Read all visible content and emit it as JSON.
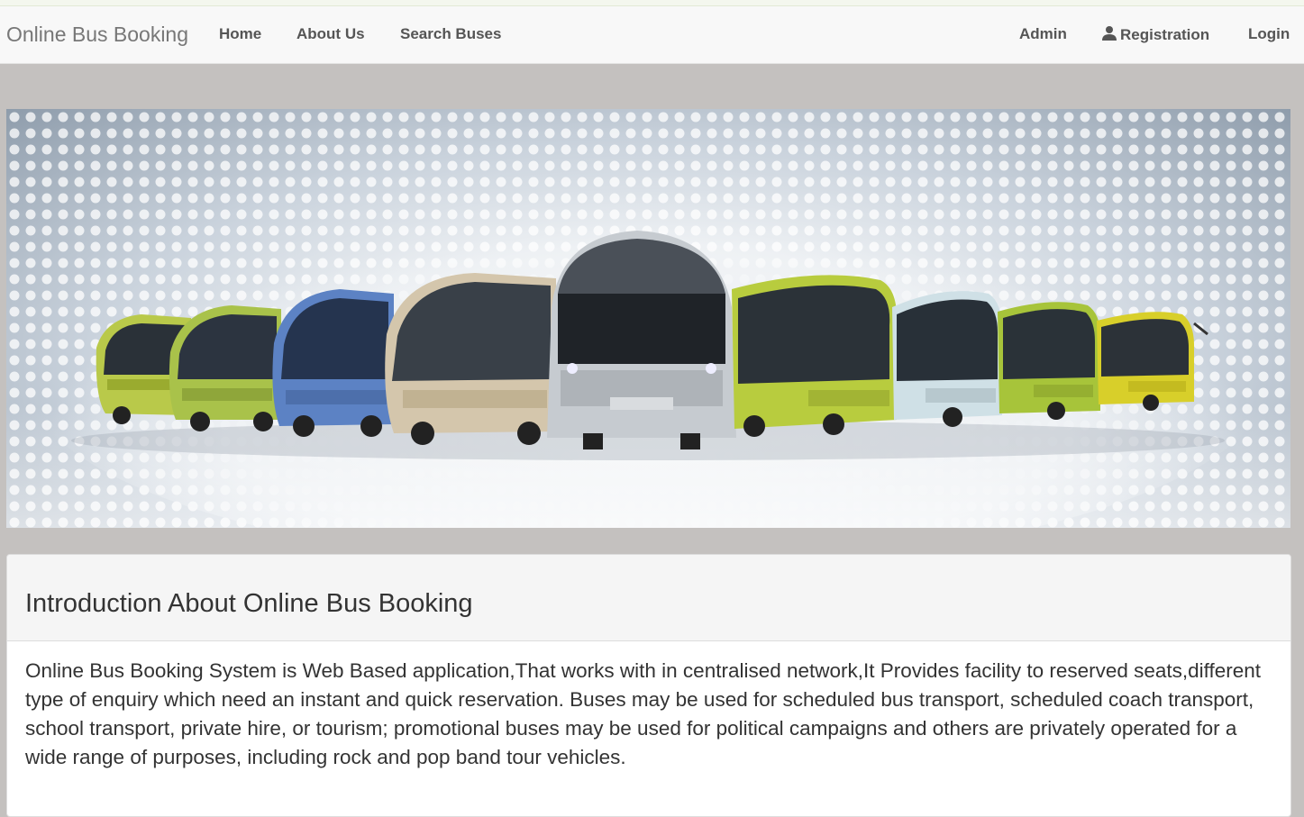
{
  "navbar": {
    "brand": "Online Bus Booking",
    "links_left": [
      "Home",
      "About Us",
      "Search Buses"
    ],
    "admin": "Admin",
    "registration": "Registration",
    "login": "Login"
  },
  "icons": {
    "registration": "user-icon"
  },
  "panel": {
    "title": "Introduction About Online Bus Booking",
    "body": "Online Bus Booking System is Web Based application,That works with in centralised network,It Provides facility to reserved seats,different type of enquiry which need an instant and quick reservation. Buses may be used for scheduled bus transport, scheduled coach transport, school transport, private hire, or tourism; promotional buses may be used for political campaigns and others are privately operated for a wide range of purposes, including rock and pop band tour vehicles."
  }
}
